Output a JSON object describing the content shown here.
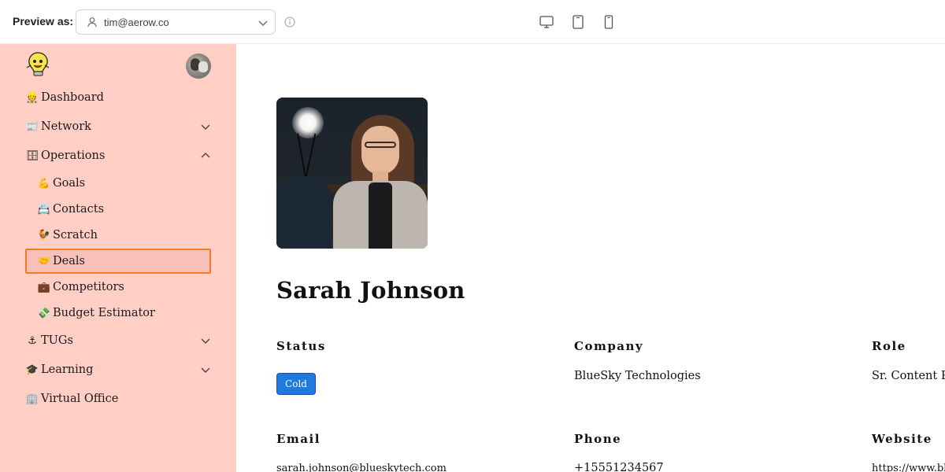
{
  "topbar": {
    "preview_label": "Preview as:",
    "user_value": "tim@aerow.co"
  },
  "sidebar": {
    "items": [
      {
        "emoji": "👷",
        "label": "Dashboard"
      },
      {
        "emoji": "📰",
        "label": "Network"
      },
      {
        "emoji": "🗄",
        "label": "Operations"
      },
      {
        "emoji": "💪",
        "label": "Goals"
      },
      {
        "emoji": "📇",
        "label": "Contacts"
      },
      {
        "emoji": "🐓",
        "label": "Scratch"
      },
      {
        "emoji": "🤝",
        "label": "Deals"
      },
      {
        "emoji": "💼",
        "label": "Competitors"
      },
      {
        "emoji": "💸",
        "label": "Budget Estimator"
      },
      {
        "emoji": "⚓",
        "label": "TUGs"
      },
      {
        "emoji": "🎓",
        "label": "Learning"
      },
      {
        "emoji": "🏢",
        "label": "Virtual Office"
      }
    ]
  },
  "profile": {
    "name": "Sarah Johnson",
    "fields": {
      "status": {
        "label": "Status",
        "value": "Cold"
      },
      "company": {
        "label": "Company",
        "value": "BlueSky Technologies"
      },
      "role": {
        "label": "Role",
        "value": "Sr. Content Pl"
      },
      "email": {
        "label": "Email",
        "value": "sarah.johnson@blueskytech.com"
      },
      "phone": {
        "label": "Phone",
        "value": "+15551234567"
      },
      "website": {
        "label": "Website",
        "value": "https://www.bl"
      }
    }
  },
  "colors": {
    "sidebar_bg": "#ffcfc6",
    "active_border": "#f47a1f",
    "status_badge": "#1f7ae0"
  }
}
